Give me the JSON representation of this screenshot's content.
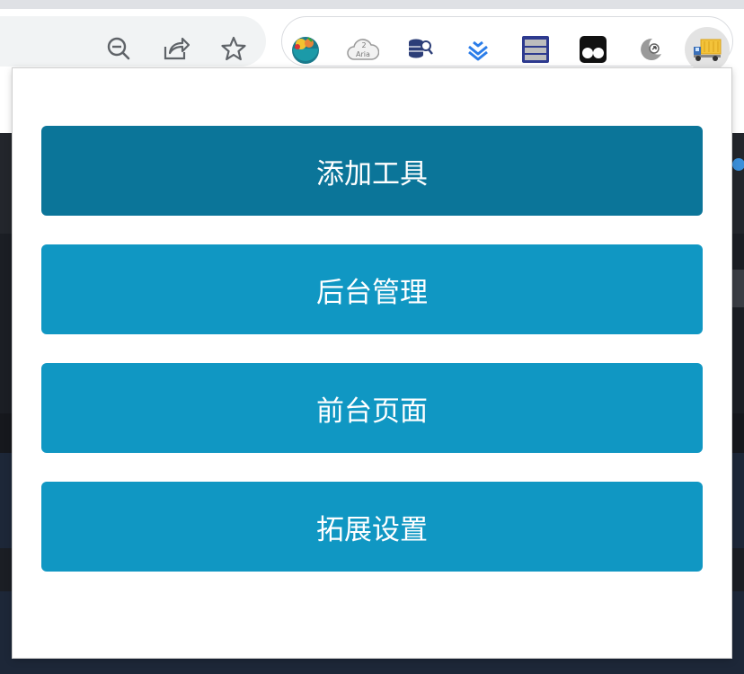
{
  "menu": {
    "items": [
      {
        "label": "添加工具"
      },
      {
        "label": "后台管理"
      },
      {
        "label": "前台页面"
      },
      {
        "label": "拓展设置"
      }
    ]
  },
  "colors": {
    "active_button": "#0b7599",
    "button": "#1097c3",
    "text": "#ffffff"
  },
  "toolbar": {
    "icons": [
      "zoom-out-icon",
      "share-icon",
      "bookmark-star-icon"
    ],
    "extensions": [
      "fruit-bowl-extension-icon",
      "aria2-cloud-extension-icon",
      "database-search-extension-icon",
      "layers-extension-icon",
      "window-panel-extension-icon",
      "eyes-extension-icon",
      "moon-arrow-extension-icon",
      "truck-extension-icon"
    ],
    "aria_badge": "2",
    "aria_label": "Aria"
  }
}
